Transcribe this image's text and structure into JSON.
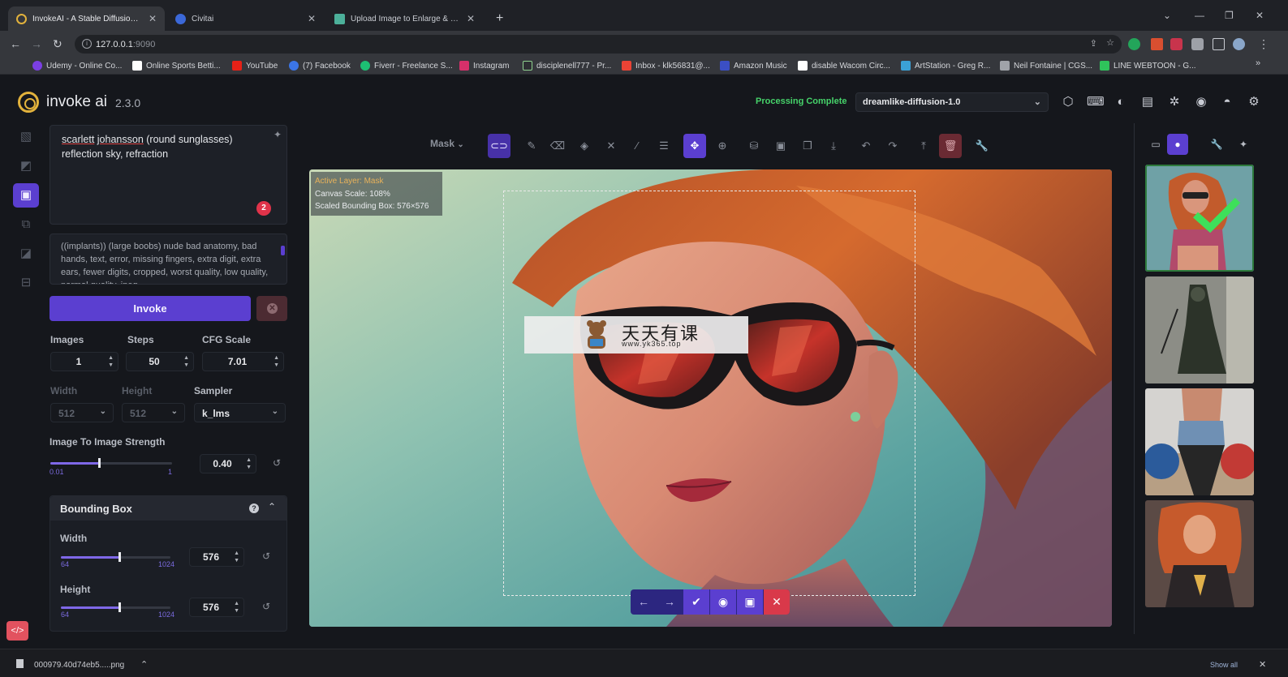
{
  "browser": {
    "tabs": [
      {
        "title": "InvokeAI - A Stable Diffusion Toolk",
        "active": true
      },
      {
        "title": "Civitai",
        "active": false
      },
      {
        "title": "Upload Image to Enlarge & Enhance",
        "active": false
      }
    ],
    "url_host": "127.0.0.1",
    "url_port": ":9090",
    "bookmarks": [
      "Udemy - Online Co...",
      "Online Sports Betti...",
      "YouTube",
      "(7) Facebook",
      "Fiverr - Freelance S...",
      "Instagram",
      "disciplenell777 - Pr...",
      "Inbox - klk56831@...",
      "Amazon Music",
      "disable Wacom Circ...",
      "ArtStation - Greg R...",
      "Neil Fontaine | CGS...",
      "LINE WEBTOON - G..."
    ]
  },
  "app": {
    "brand": "invoke ai",
    "version": "2.3.0",
    "status": "Processing Complete",
    "model": "dreamlike-diffusion-1.0"
  },
  "prompt": {
    "word1": "scarlett",
    "word2": "johansson",
    "rest": " (round sunglasses) reflection sky, refraction",
    "badge": "2"
  },
  "negative_prompt": "((implants)) (large boobs) nude bad anatomy, bad hands, text, error, missing fingers, extra digit, extra ears, fewer digits, cropped, worst quality, low quality, normal quality, jpeg",
  "invoke_label": "Invoke",
  "params": {
    "images_label": "Images",
    "images": "1",
    "steps_label": "Steps",
    "steps": "50",
    "cfg_label": "CFG Scale",
    "cfg": "7.01",
    "width_label": "Width",
    "width": "512",
    "height_label": "Height",
    "height": "512",
    "sampler_label": "Sampler",
    "sampler": "k_lms",
    "strength_label": "Image To Image Strength",
    "strength": "0.40",
    "strength_min": "0.01",
    "strength_max": "1",
    "strength_fraction": 0.4
  },
  "bounding_box": {
    "title": "Bounding Box",
    "width_label": "Width",
    "width": "576",
    "height_label": "Height",
    "height": "576",
    "min": "64",
    "max": "1024",
    "width_fraction": 0.53,
    "height_fraction": 0.53
  },
  "canvas_toolbar": {
    "layer_select": "Mask"
  },
  "canvas_info": {
    "active_layer": "Active Layer: Mask",
    "canvas_scale": "Canvas Scale: 108%",
    "scaled_bbox": "Scaled Bounding Box: 576×576"
  },
  "watermark": {
    "chinese": "天天有课",
    "url": "www.yk365.top"
  },
  "downloads": {
    "file": "000979.40d74eb5.....png",
    "show_all": "Show all"
  },
  "colors": {
    "accent": "#5b3fd0",
    "success": "#46d36a",
    "danger": "#d9394a"
  }
}
